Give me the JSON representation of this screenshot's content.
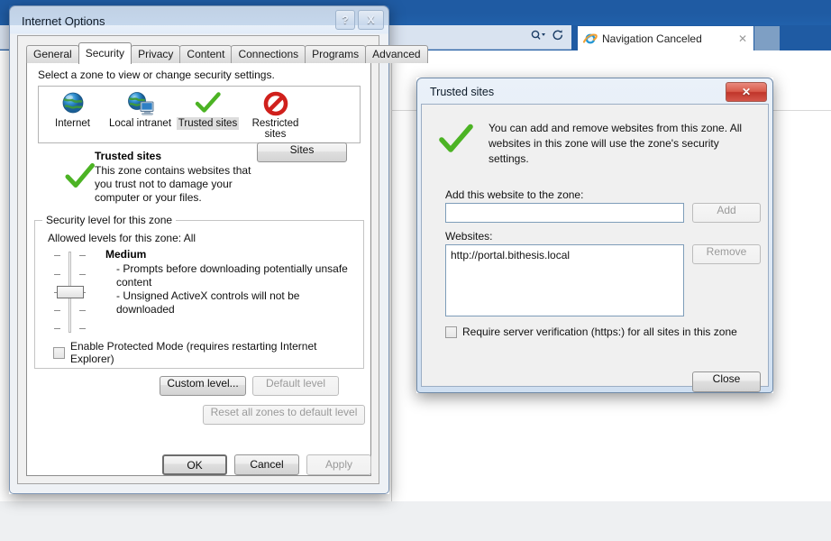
{
  "background": {
    "browser": {
      "tab_label": "Navigation Canceled",
      "tab_close_icon": "close-icon",
      "ie_logo_icon": "internet-explorer-icon",
      "search_icon": "search-dropdown-icon",
      "refresh_icon": "refresh-icon",
      "newtab_label": ""
    }
  },
  "internet_options": {
    "title": "Internet Options",
    "window_buttons": {
      "help": "?",
      "close": "X"
    },
    "tabs": [
      {
        "label": "General",
        "active": false
      },
      {
        "label": "Security",
        "active": true
      },
      {
        "label": "Privacy",
        "active": false
      },
      {
        "label": "Content",
        "active": false
      },
      {
        "label": "Connections",
        "active": false
      },
      {
        "label": "Programs",
        "active": false
      },
      {
        "label": "Advanced",
        "active": false
      }
    ],
    "security": {
      "zone_prompt": "Select a zone to view or change security settings.",
      "zones": [
        {
          "label": "Internet",
          "icon": "globe-icon",
          "selected": false
        },
        {
          "label": "Local intranet",
          "icon": "globe-computer-icon",
          "selected": false
        },
        {
          "label": "Trusted sites",
          "icon": "green-check-icon",
          "selected": true
        },
        {
          "label": "Restricted sites",
          "icon": "red-prohibited-icon",
          "selected": false
        }
      ],
      "selected_zone": {
        "icon": "green-check-icon",
        "name": "Trusted sites",
        "description": "This zone contains websites that you trust not to damage your computer or your files."
      },
      "sites_button": "Sites",
      "level_group_title": "Security level for this zone",
      "allowed_levels": "Allowed levels for this zone: All",
      "level_name": "Medium",
      "level_bullets": [
        "- Prompts before downloading potentially unsafe content",
        "- Unsigned ActiveX controls will not be downloaded"
      ],
      "slider_ticks": 5,
      "slider_position_index": 2,
      "protected_mode_label": "Enable Protected Mode (requires restarting Internet Explorer)",
      "protected_mode_checked": false,
      "custom_level_button": "Custom level...",
      "default_level_button": "Default level",
      "default_level_disabled": true,
      "reset_all_button": "Reset all zones to default level",
      "reset_all_disabled": true
    },
    "footer": {
      "ok": "OK",
      "cancel": "Cancel",
      "apply": "Apply",
      "apply_disabled": true
    }
  },
  "trusted_sites": {
    "title": "Trusted sites",
    "close_icon": "close-icon",
    "intro_icon": "green-check-icon",
    "intro_text": "You can add and remove websites from this zone. All websites in this zone will use the zone's security settings.",
    "add_label": "Add this website to the zone:",
    "add_input_value": "",
    "add_input_placeholder": "",
    "add_button": "Add",
    "add_button_disabled": true,
    "websites_label": "Websites:",
    "websites": [
      "http://portal.bithesis.local"
    ],
    "remove_button": "Remove",
    "remove_button_disabled": true,
    "require_verification_label": "Require server verification (https:) for all sites in this zone",
    "require_verification_checked": false,
    "close_button": "Close"
  },
  "colors": {
    "ie_titlebar_blue": "#1f5ba3",
    "dialog_face": "#f0f0f0",
    "accent_green": "#4cb324",
    "close_red": "#c0352a",
    "aero_glass": "#dfe8f4"
  }
}
